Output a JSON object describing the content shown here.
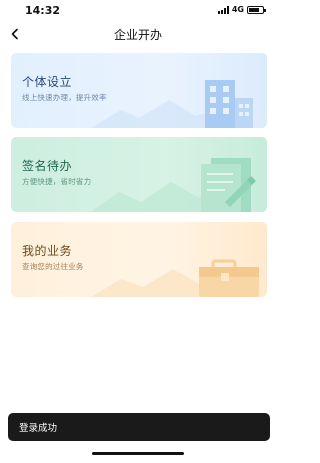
{
  "status_bar": {
    "time": "14:32",
    "network": "4G",
    "battery_level": 0.75,
    "icons": [
      "signal-icon",
      "battery-icon"
    ]
  },
  "nav": {
    "title": "企业开办",
    "back_icon": "chevron-left-icon"
  },
  "cards": [
    {
      "title": "个体设立",
      "subtitle": "线上快速办理，提升效率",
      "icon": "building-icon",
      "color": "#e4f0fd"
    },
    {
      "title": "签名待办",
      "subtitle": "方便快捷，省时省力",
      "icon": "document-pen-icon",
      "color": "#d2f0e3"
    },
    {
      "title": "我的业务",
      "subtitle": "查询您的过往业务",
      "icon": "briefcase-icon",
      "color": "#fff1de"
    }
  ],
  "toast": {
    "text": "登录成功"
  }
}
